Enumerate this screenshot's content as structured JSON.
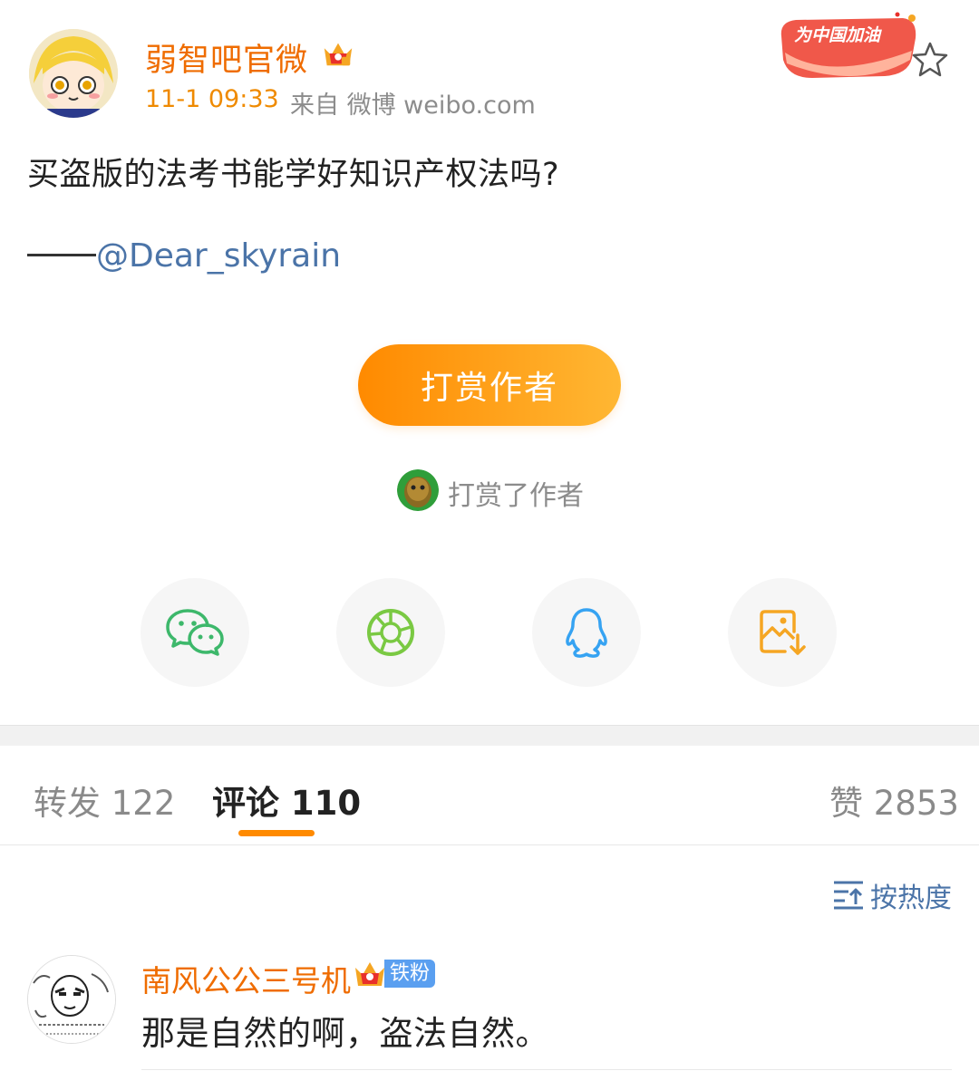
{
  "post": {
    "username": "弱智吧官微",
    "time": "11-1 09:33",
    "source": "来自 微博 weibo.com",
    "promo_badge": "为中国加油",
    "text": "买盗版的法考书能学好知识产权法吗?",
    "mention": "@Dear_skyrain"
  },
  "reward": {
    "button_label": "打赏作者",
    "rewarded_text": "打赏了作者"
  },
  "share": {
    "icons": [
      "wechat-icon",
      "moments-icon",
      "qq-icon",
      "save-image-icon"
    ]
  },
  "tabs": {
    "repost_label": "转发",
    "repost_count": "122",
    "comment_label": "评论",
    "comment_count": "110",
    "like_label": "赞",
    "like_count": "2853"
  },
  "sort": {
    "label": "按热度"
  },
  "comments": [
    {
      "username": "南风公公三号机",
      "badge": "铁粉",
      "text": "那是自然的啊，盗法自然。"
    }
  ],
  "colors": {
    "accent_orange": "#ff8a00",
    "username_orange": "#ef6c00",
    "link_blue": "#4b74a8",
    "badge_blue": "#5a9ff0"
  }
}
